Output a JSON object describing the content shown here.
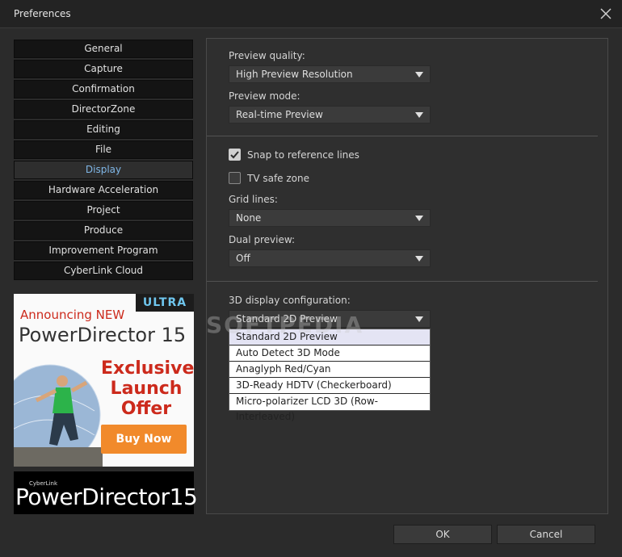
{
  "window": {
    "title": "Preferences"
  },
  "nav": {
    "items": [
      {
        "label": "General"
      },
      {
        "label": "Capture"
      },
      {
        "label": "Confirmation"
      },
      {
        "label": "DirectorZone"
      },
      {
        "label": "Editing"
      },
      {
        "label": "File"
      },
      {
        "label": "Display",
        "active": true
      },
      {
        "label": "Hardware Acceleration"
      },
      {
        "label": "Project"
      },
      {
        "label": "Produce"
      },
      {
        "label": "Improvement Program"
      },
      {
        "label": "CyberLink Cloud"
      }
    ]
  },
  "ad": {
    "badge": "ULTRA",
    "announce": "Announcing NEW",
    "product": "PowerDirector 15",
    "offer_line1": "Exclusive",
    "offer_line2": "Launch",
    "offer_line3": "Offer",
    "buy_label": "Buy Now"
  },
  "logo": {
    "brand": "CyberLink",
    "product": "PowerDirector",
    "version": "15"
  },
  "display": {
    "preview_quality_label": "Preview quality:",
    "preview_quality_value": "High Preview Resolution",
    "preview_mode_label": "Preview mode:",
    "preview_mode_value": "Real-time Preview",
    "snap_label": "Snap to reference lines",
    "snap_checked": true,
    "tv_safe_label": "TV safe zone",
    "tv_safe_checked": false,
    "grid_lines_label": "Grid lines:",
    "grid_lines_value": "None",
    "dual_preview_label": "Dual preview:",
    "dual_preview_value": "Off",
    "config3d_label": "3D display configuration:",
    "config3d_value": "Standard 2D Preview",
    "config3d_options": [
      "Standard 2D Preview",
      "Auto Detect 3D Mode",
      "Anaglyph Red/Cyan",
      "3D-Ready HDTV (Checkerboard)",
      "Micro-polarizer LCD 3D (Row-Interleaved)"
    ]
  },
  "watermark": "SOFTPEDIA",
  "buttons": {
    "ok": "OK",
    "cancel": "Cancel"
  },
  "colors": {
    "active_nav": "#7fb6e6",
    "ad_red": "#cc2a1c",
    "buy_orange": "#f18a2b"
  }
}
